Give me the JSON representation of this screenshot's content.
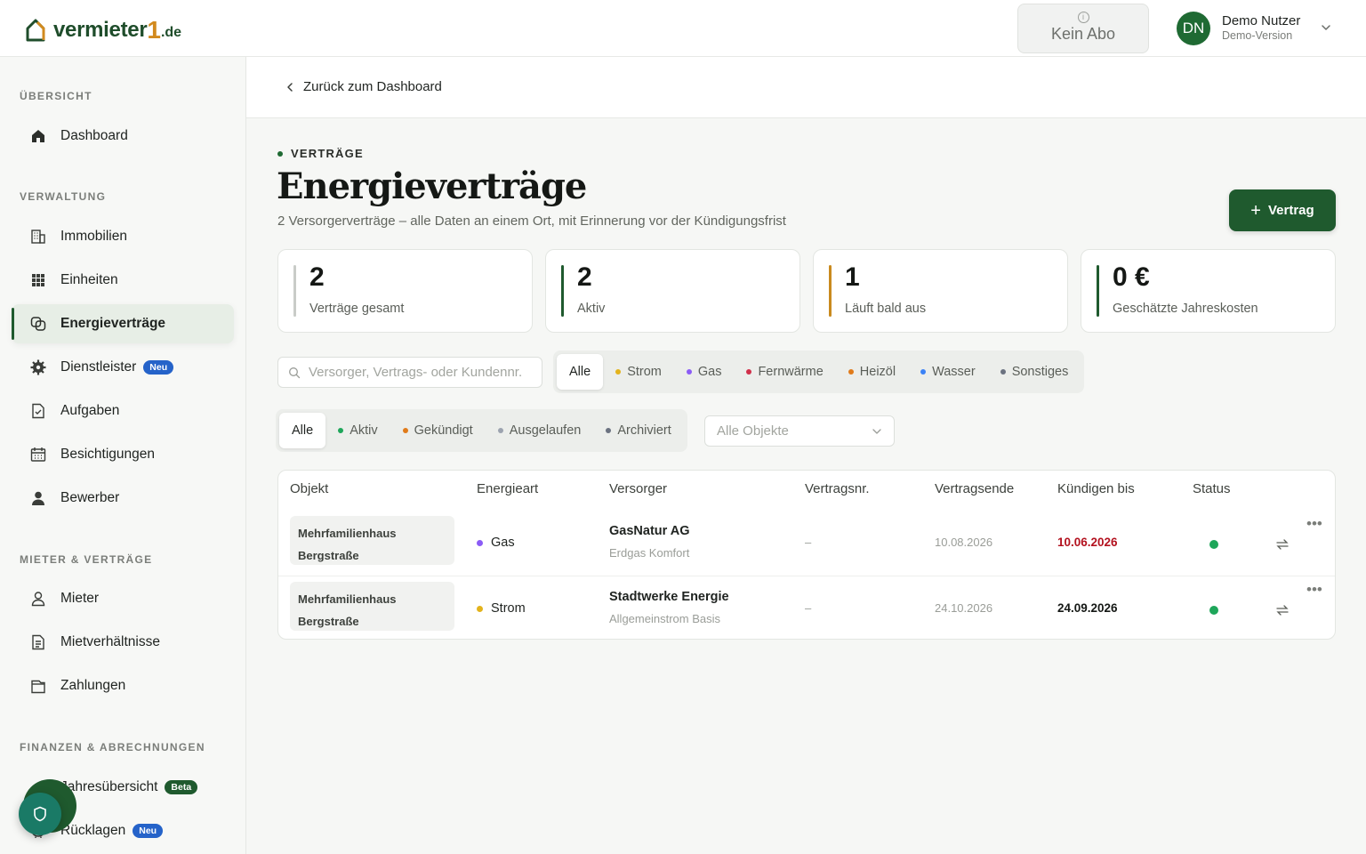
{
  "brand": {
    "name": "vermieter",
    "digit": "1",
    "tld": ".de"
  },
  "topbar": {
    "subscription_label": "Kein Abo",
    "user": {
      "initials": "DN",
      "name": "Demo Nutzer",
      "role": "Demo-Version"
    }
  },
  "sidebar": {
    "sections": [
      {
        "title": "ÜBERSICHT"
      },
      {
        "title": "VERWALTUNG"
      },
      {
        "title": "MIETER & VERTRÄGE"
      },
      {
        "title": "FINANZEN & ABRECHNUNGEN"
      }
    ],
    "items": [
      {
        "label": "Dashboard",
        "icon": "home-icon"
      },
      {
        "label": "Immobilien",
        "icon": "building-icon"
      },
      {
        "label": "Einheiten",
        "icon": "grid-icon"
      },
      {
        "label": "Energieverträge",
        "icon": "contracts-icon"
      },
      {
        "label": "Dienstleister",
        "icon": "gear-icon",
        "badge": "Neu"
      },
      {
        "label": "Aufgaben",
        "icon": "task-icon"
      },
      {
        "label": "Besichtigungen",
        "icon": "calendar-icon"
      },
      {
        "label": "Bewerber",
        "icon": "person-filled-icon"
      },
      {
        "label": "Mieter",
        "icon": "person-outline-icon"
      },
      {
        "label": "Mietverhältnisse",
        "icon": "document-icon"
      },
      {
        "label": "Zahlungen",
        "icon": "wallet-icon"
      },
      {
        "label": "Jahresübersicht",
        "icon": "chart-icon",
        "badge": "Beta"
      },
      {
        "label": "Rücklagen",
        "icon": "piggy-icon",
        "badge": "Neu"
      }
    ],
    "active": "Energieverträge"
  },
  "back": {
    "label": "Zurück zum Dashboard"
  },
  "header": {
    "eyebrow": "VERTRÄGE",
    "title": "Energieverträge",
    "subtitle": "2 Versorgerverträge – alle Daten an einem Ort, mit Erinnerung vor der Kündigungsfrist",
    "add_button": "Vertrag"
  },
  "stats": [
    {
      "value": "2",
      "label": "Verträge gesamt",
      "color": "#c9ccc8"
    },
    {
      "value": "2",
      "label": "Aktiv",
      "color": "#1f5a2e"
    },
    {
      "value": "1",
      "label": "Läuft bald aus",
      "color": "#c98a1e"
    },
    {
      "value": "0 €",
      "label": "Geschätzte Jahreskosten",
      "color": "#1f5a2e"
    }
  ],
  "filters": {
    "search_placeholder": "Versorger, Vertrags- oder Kundennr.",
    "energy_types": [
      {
        "label": "Alle",
        "selected": true
      },
      {
        "label": "Strom",
        "color": "#e3b31c"
      },
      {
        "label": "Gas",
        "color": "#8b5cf6"
      },
      {
        "label": "Fernwärme",
        "color": "#d0304a"
      },
      {
        "label": "Heizöl",
        "color": "#e07b1a"
      },
      {
        "label": "Wasser",
        "color": "#3b82f6"
      },
      {
        "label": "Sonstiges",
        "color": "#6b7280"
      }
    ],
    "statuses": [
      {
        "label": "Alle",
        "selected": true
      },
      {
        "label": "Aktiv",
        "color": "#1ea65a"
      },
      {
        "label": "Gekündigt",
        "color": "#e07b1a"
      },
      {
        "label": "Ausgelaufen",
        "color": "#9ca3af"
      },
      {
        "label": "Archiviert",
        "color": "#6b7280"
      }
    ],
    "object_select": "Alle Objekte"
  },
  "table": {
    "columns": [
      "Objekt",
      "Energieart",
      "Versorger",
      "Vertragsnr.",
      "Vertragsende",
      "Kündigen bis",
      "Status"
    ],
    "rows": [
      {
        "object_line1": "Mehrfamilienhaus",
        "object_line2": "Bergstraße",
        "energy": "Gas",
        "energy_color": "#8b5cf6",
        "provider": "GasNatur AG",
        "tariff": "Erdgas Komfort",
        "contract_no": "–",
        "end": "10.08.2026",
        "cancel_by": "10.06.2026",
        "cancel_color": "#b3121f",
        "status_color": "#1ea65a"
      },
      {
        "object_line1": "Mehrfamilienhaus",
        "object_line2": "Bergstraße",
        "energy": "Strom",
        "energy_color": "#e3b31c",
        "provider": "Stadtwerke Energie",
        "tariff": "Allgemeinstrom Basis",
        "contract_no": "–",
        "end": "24.10.2026",
        "cancel_by": "24.09.2026",
        "cancel_color": "#151815",
        "status_color": "#1ea65a"
      }
    ]
  }
}
